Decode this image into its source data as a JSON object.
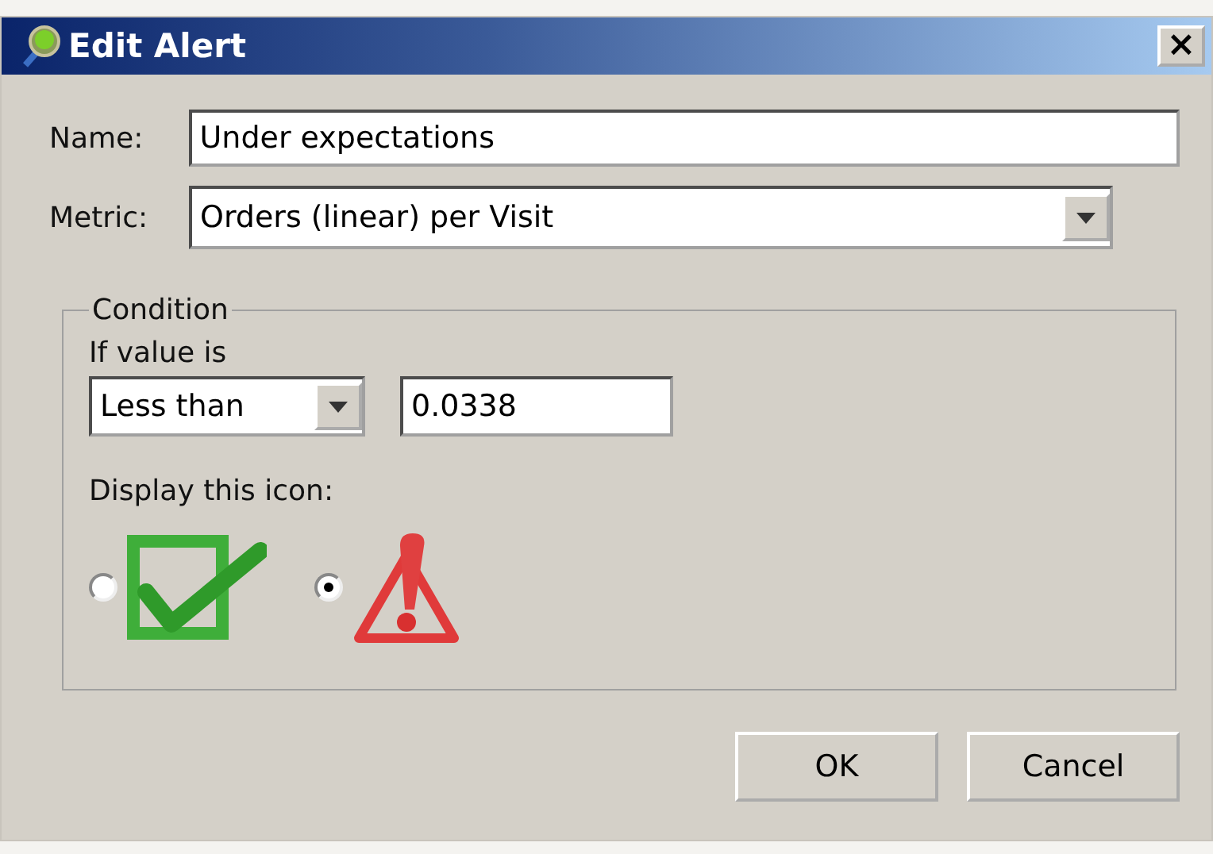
{
  "window": {
    "title": "Edit Alert",
    "close": "×"
  },
  "name_field": {
    "label": "Name:",
    "value": "Under expectations"
  },
  "metric_field": {
    "label": "Metric:",
    "value": "Orders (linear) per Visit"
  },
  "condition": {
    "legend": "Condition",
    "operator_label": "If value is",
    "operator": "Less than",
    "threshold": "0.0338",
    "icon_label": "Display this icon:",
    "icons": [
      {
        "kind": "check",
        "selected": false
      },
      {
        "kind": "warning",
        "selected": true
      }
    ]
  },
  "buttons": [
    "OK",
    "Cancel"
  ]
}
